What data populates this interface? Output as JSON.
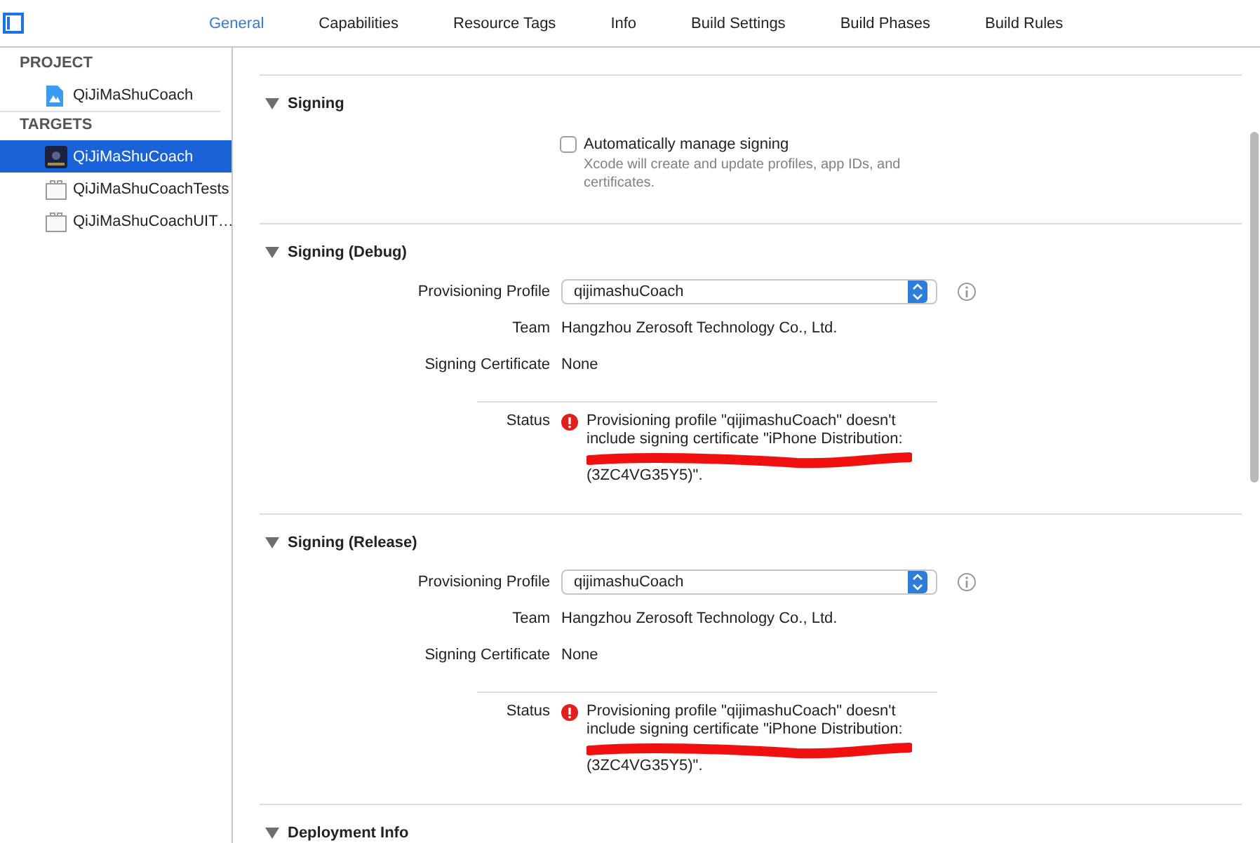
{
  "tabs": [
    {
      "label": "General",
      "selected": true
    },
    {
      "label": "Capabilities",
      "selected": false
    },
    {
      "label": "Resource Tags",
      "selected": false
    },
    {
      "label": "Info",
      "selected": false
    },
    {
      "label": "Build Settings",
      "selected": false
    },
    {
      "label": "Build Phases",
      "selected": false
    },
    {
      "label": "Build Rules",
      "selected": false
    }
  ],
  "sidebar": {
    "groups": [
      {
        "title": "PROJECT",
        "items": [
          {
            "label": "QiJiMaShuCoach",
            "kind": "project",
            "selected": false
          }
        ]
      },
      {
        "title": "TARGETS",
        "items": [
          {
            "label": "QiJiMaShuCoach",
            "kind": "app",
            "selected": true
          },
          {
            "label": "QiJiMaShuCoachTests",
            "kind": "bundle",
            "selected": false
          },
          {
            "label": "QiJiMaShuCoachUIT…",
            "kind": "bundle",
            "selected": false
          }
        ]
      }
    ]
  },
  "sections": [
    {
      "title": "Signing",
      "kind": "auto",
      "expanded": true,
      "checkbox": {
        "label": "Automatically manage signing",
        "checked": false,
        "description": "Xcode will create and update profiles, app IDs, and certificates."
      }
    },
    {
      "title": "Signing (Debug)",
      "kind": "fields",
      "expanded": true,
      "profile_label": "Provisioning Profile",
      "profile": "qijimashuCoach",
      "team_label": "Team",
      "team": "Hangzhou Zerosoft Technology Co., Ltd.",
      "cert_label": "Signing Certificate",
      "cert": "None",
      "status_label": "Status",
      "status_lines": [
        "Provisioning profile \"qijimashuCoach\" doesn't",
        "include signing certificate \"iPhone Distribution:",
        "(3ZC4VG35Y5)\"."
      ],
      "redacted": true
    },
    {
      "title": "Signing (Release)",
      "kind": "fields",
      "expanded": true,
      "profile_label": "Provisioning Profile",
      "profile": "qijimashuCoach",
      "team_label": "Team",
      "team": "Hangzhou Zerosoft Technology Co., Ltd.",
      "cert_label": "Signing Certificate",
      "cert": "None",
      "status_label": "Status",
      "status_lines": [
        "Provisioning profile \"qijimashuCoach\" doesn't",
        "include signing certificate \"iPhone Distribution:",
        "(3ZC4VG35Y5)\"."
      ],
      "redacted": true
    },
    {
      "title": "Deployment Info",
      "kind": "header",
      "expanded": true
    }
  ]
}
